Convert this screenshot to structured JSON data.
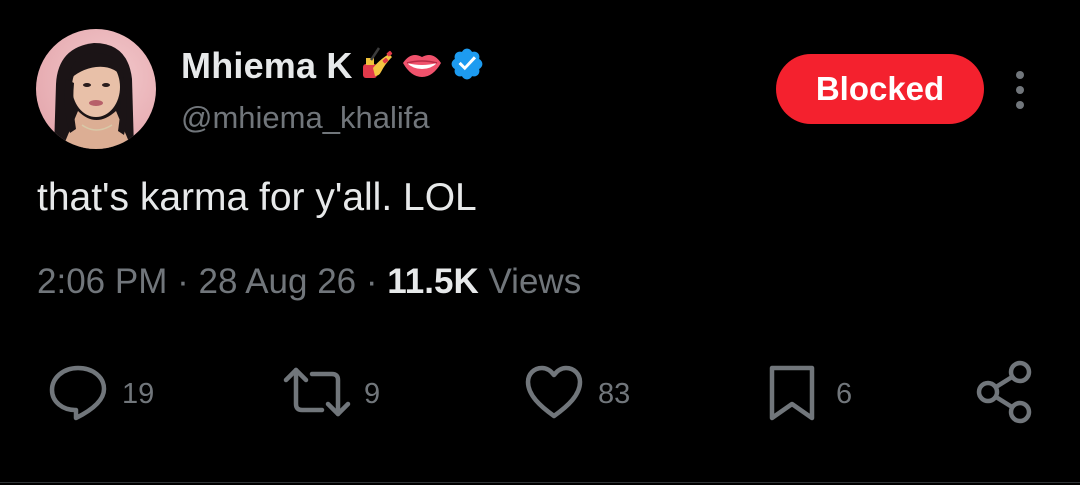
{
  "author": {
    "display_name": "Mhiema K",
    "handle": "@mhiema_khalifa",
    "name_emojis": [
      "nail-polish-emoji",
      "lips-emoji"
    ],
    "verified": true
  },
  "actions_top": {
    "blocked_label": "Blocked"
  },
  "tweet": {
    "text": "that's karma for y'all. LOL",
    "time": "2:06 PM",
    "separator": "·",
    "date": "28 Aug 26",
    "views_count": "11.5K",
    "views_label": "Views"
  },
  "engagement": {
    "replies": "19",
    "reposts": "9",
    "likes": "83",
    "bookmarks": "6"
  },
  "colors": {
    "background": "#000000",
    "primary_text": "#e7e9ea",
    "secondary_text": "#71767b",
    "blocked_red": "#f4212e",
    "verified_blue": "#1d9bf0"
  }
}
